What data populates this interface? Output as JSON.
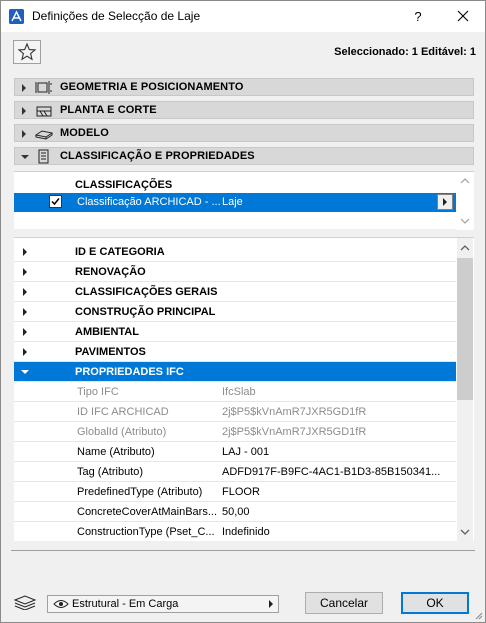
{
  "window": {
    "title": "Definições de Selecção de Laje",
    "help_label": "?",
    "selection_info": "Seleccionado: 1 Editável: 1"
  },
  "panels": [
    {
      "label": "GEOMETRIA E POSICIONAMENTO",
      "icon": "geometry-icon",
      "expanded": false
    },
    {
      "label": "PLANTA E CORTE",
      "icon": "floor-plan-icon",
      "expanded": false
    },
    {
      "label": "MODELO",
      "icon": "model-icon",
      "expanded": false
    },
    {
      "label": "CLASSIFICAÇÃO E PROPRIEDADES",
      "icon": "classification-icon",
      "expanded": true
    }
  ],
  "classifications": {
    "title": "CLASSIFICAÇÕES",
    "row": {
      "name": "Classificação ARCHICAD - ...",
      "value": "Laje",
      "checked": true
    }
  },
  "property_groups": [
    {
      "label": "ID E CATEGORIA"
    },
    {
      "label": "RENOVAÇÃO"
    },
    {
      "label": "CLASSIFICAÇÕES GERAIS"
    },
    {
      "label": "CONSTRUÇÃO PRINCIPAL"
    },
    {
      "label": "AMBIENTAL"
    },
    {
      "label": "PAVIMENTOS"
    },
    {
      "label": "PROPRIEDADES IFC"
    }
  ],
  "ifc_properties": [
    {
      "key": "Tipo IFC",
      "value": "IfcSlab",
      "readonly": true
    },
    {
      "key": "ID IFC ARCHICAD",
      "value": "2j$P5$kVnAmR7JXR5GD1fR",
      "readonly": true
    },
    {
      "key": "GlobalId (Atributo)",
      "value": "2j$P5$kVnAmR7JXR5GD1fR",
      "readonly": true
    },
    {
      "key": "Name (Atributo)",
      "value": "LAJ - 001",
      "readonly": false
    },
    {
      "key": "Tag (Atributo)",
      "value": "ADFD917F-B9FC-4AC1-B1D3-85B150341...",
      "readonly": false
    },
    {
      "key": "PredefinedType (Atributo)",
      "value": "FLOOR",
      "readonly": false
    },
    {
      "key": "ConcreteCoverAtMainBars...",
      "value": "50,00",
      "readonly": false
    },
    {
      "key": "ConstructionType (Pset_C...",
      "value": "Indefinido",
      "readonly": false
    }
  ],
  "footer": {
    "layer_label": "Estrutural - Em Carga",
    "cancel_label": "Cancelar",
    "ok_label": "OK"
  }
}
